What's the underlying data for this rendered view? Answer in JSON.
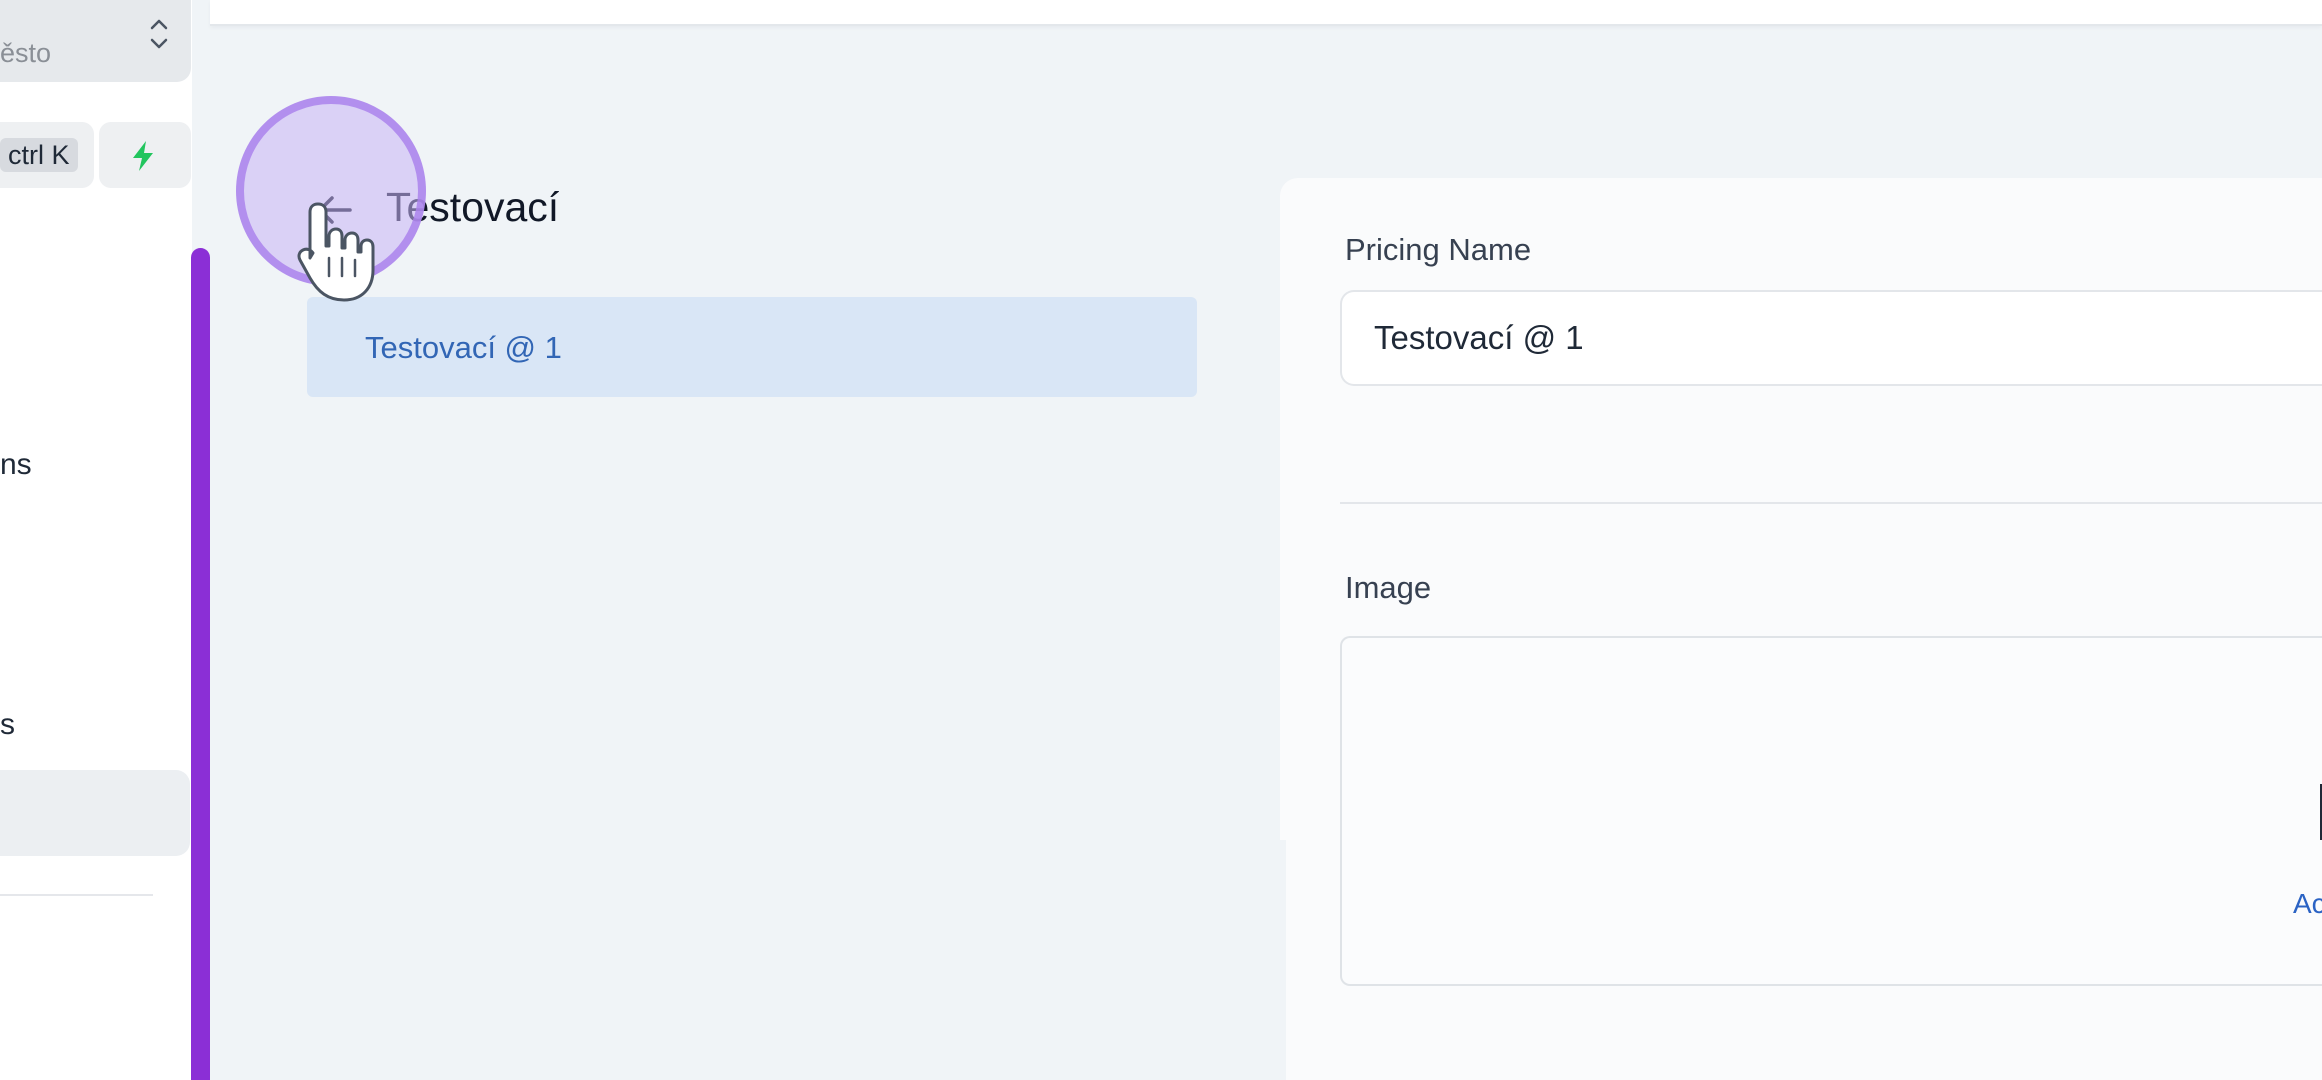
{
  "sidebar": {
    "select_value_fragment": "ěsto",
    "shortcut_hint": "ctrl K",
    "nav_fragment_1": "ns",
    "nav_fragment_2": "s",
    "accent_color": "#8b2fd6"
  },
  "list_panel": {
    "title": "Testovací",
    "items": [
      {
        "label": "Testovací @ 1"
      }
    ]
  },
  "form": {
    "pricing_name_label": "Pricing Name",
    "pricing_name_value": "Testovací @ 1",
    "image_label": "Image",
    "image_action_fragment": "Ac"
  },
  "colors": {
    "background": "#f0f4f7",
    "list_selected_bg": "#d9e6f6",
    "link": "#3266b5",
    "bolt": "#22c55e"
  }
}
